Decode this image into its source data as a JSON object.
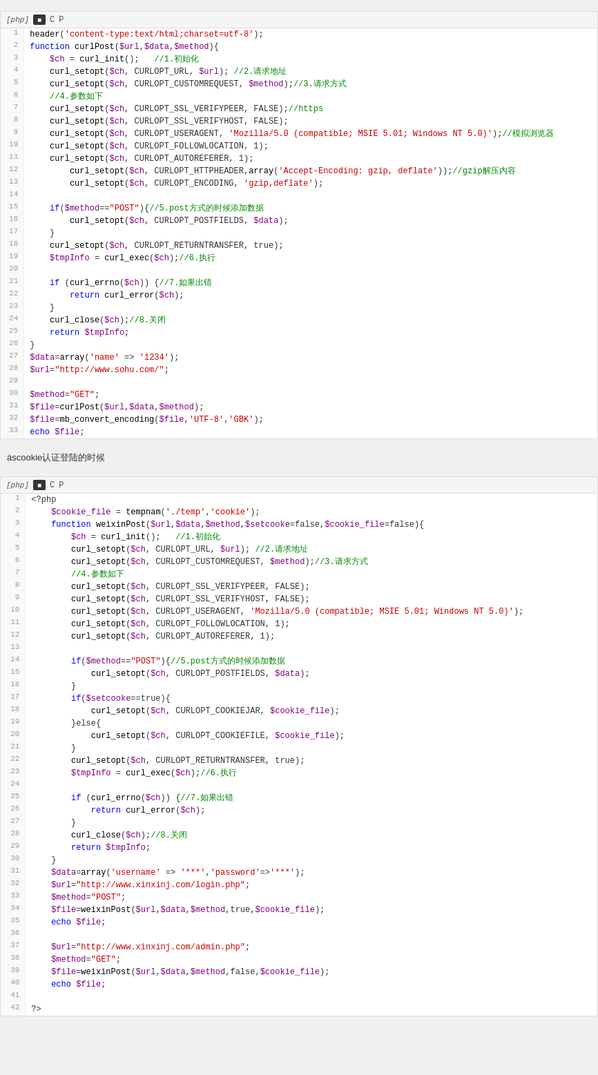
{
  "blocks": [
    {
      "id": "block1",
      "lang": "[php]",
      "lines": [
        {
          "n": 1,
          "html": "<span class='fn'>header</span><span class='plain'>(</span><span class='str'>'content-type:text/html;charset=utf-8'</span><span class='plain'>);</span>"
        },
        {
          "n": 2,
          "html": "<span class='kw'>function</span> <span class='fn'>curlPost</span><span class='plain'>(</span><span class='var'>$url</span><span class='plain'>,</span><span class='var'>$data</span><span class='plain'>,</span><span class='var'>$method</span><span class='plain'>){</span>"
        },
        {
          "n": 3,
          "html": "    <span class='var'>$ch</span><span class='plain'> = </span><span class='fn'>curl_init</span><span class='plain'>();   </span><span class='cmt'>//1.初始化</span>"
        },
        {
          "n": 4,
          "html": "    <span class='fn'>curl_setopt</span><span class='plain'>(</span><span class='var'>$ch</span><span class='plain'>, CURLOPT_URL, </span><span class='var'>$url</span><span class='plain'>); </span><span class='cmt'>//2.请求地址</span>"
        },
        {
          "n": 5,
          "html": "    <span class='fn'>curl_setopt</span><span class='plain'>(</span><span class='var'>$ch</span><span class='plain'>, CURLOPT_CUSTOMREQUEST, </span><span class='var'>$method</span><span class='plain'>);</span><span class='cmt'>//3.请求方式</span>"
        },
        {
          "n": 6,
          "html": "    <span class='cmt'>//4.参数如下</span>"
        },
        {
          "n": 7,
          "html": "    <span class='fn'>curl_setopt</span><span class='plain'>(</span><span class='var'>$ch</span><span class='plain'>, CURLOPT_SSL_VERIFYPEER, FALSE);</span><span class='cmt'>//https</span>"
        },
        {
          "n": 8,
          "html": "    <span class='fn'>curl_setopt</span><span class='plain'>(</span><span class='var'>$ch</span><span class='plain'>, CURLOPT_SSL_VERIFYHOST, FALSE);</span>"
        },
        {
          "n": 9,
          "html": "    <span class='fn'>curl_setopt</span><span class='plain'>(</span><span class='var'>$ch</span><span class='plain'>, CURLOPT_USERAGENT, </span><span class='str'>'Mozilla/5.0 (compatible; MSIE 5.01; Windows NT 5.0)'</span><span class='plain'>);</span><span class='cmt'>//模拟浏览器</span>"
        },
        {
          "n": 10,
          "html": "    <span class='fn'>curl_setopt</span><span class='plain'>(</span><span class='var'>$ch</span><span class='plain'>, CURLOPT_FOLLOWLOCATION, 1);</span>"
        },
        {
          "n": 11,
          "html": "    <span class='fn'>curl_setopt</span><span class='plain'>(</span><span class='var'>$ch</span><span class='plain'>, CURLOPT_AUTOREFERER, 1);</span>"
        },
        {
          "n": 12,
          "html": "        <span class='fn'>curl_setopt</span><span class='plain'>(</span><span class='var'>$ch</span><span class='plain'>, CURLOPT_HTTPHEADER,</span><span class='fn'>array</span><span class='plain'>(</span><span class='str'>'Accept-Encoding: gzip, deflate'</span><span class='plain'>));</span><span class='cmt'>//gzip解压内容</span>"
        },
        {
          "n": 13,
          "html": "        <span class='fn'>curl_setopt</span><span class='plain'>(</span><span class='var'>$ch</span><span class='plain'>, CURLOPT_ENCODING, </span><span class='str'>'gzip,deflate'</span><span class='plain'>);</span>"
        },
        {
          "n": 14,
          "html": ""
        },
        {
          "n": 15,
          "html": "    <span class='kw'>if</span><span class='plain'>(</span><span class='var'>$method</span><span class='plain'>==</span><span class='str'>\"POST\"</span><span class='plain'>){</span><span class='cmt'>//5.post方式的时候添加数据</span>"
        },
        {
          "n": 16,
          "html": "        <span class='fn'>curl_setopt</span><span class='plain'>(</span><span class='var'>$ch</span><span class='plain'>, CURLOPT_POSTFIELDS, </span><span class='var'>$data</span><span class='plain'>);</span>"
        },
        {
          "n": 17,
          "html": "    <span class='plain'>}</span>"
        },
        {
          "n": 18,
          "html": "    <span class='fn'>curl_setopt</span><span class='plain'>(</span><span class='var'>$ch</span><span class='plain'>, CURLOPT_RETURNTRANSFER, true);</span>"
        },
        {
          "n": 19,
          "html": "    <span class='var'>$tmpInfo</span><span class='plain'> = </span><span class='fn'>curl_exec</span><span class='plain'>(</span><span class='var'>$ch</span><span class='plain'>);</span><span class='cmt'>//6.执行</span>"
        },
        {
          "n": 20,
          "html": ""
        },
        {
          "n": 21,
          "html": "    <span class='kw'>if</span><span class='plain'> (</span><span class='fn'>curl_errno</span><span class='plain'>(</span><span class='var'>$ch</span><span class='plain'>)) {</span><span class='cmt'>//7.如果出错</span>"
        },
        {
          "n": 22,
          "html": "        <span class='kw'>return</span> <span class='fn'>curl_error</span><span class='plain'>(</span><span class='var'>$ch</span><span class='plain'>);</span>"
        },
        {
          "n": 23,
          "html": "    <span class='plain'>}</span>"
        },
        {
          "n": 24,
          "html": "    <span class='fn'>curl_close</span><span class='plain'>(</span><span class='var'>$ch</span><span class='plain'>);</span><span class='cmt'>//8.关闭</span>"
        },
        {
          "n": 25,
          "html": "    <span class='kw'>return</span> <span class='var'>$tmpInfo</span><span class='plain'>;</span>"
        },
        {
          "n": 26,
          "html": "<span class='plain'>}</span>"
        },
        {
          "n": 27,
          "html": "<span class='var'>$data</span><span class='plain'>=</span><span class='fn'>array</span><span class='plain'>(</span><span class='str'>'name'</span><span class='plain'> => </span><span class='str'>'1234'</span><span class='plain'>);</span>"
        },
        {
          "n": 28,
          "html": "<span class='var'>$url</span><span class='plain'>=</span><span class='str'>\"http://www.sohu.com/\"</span><span class='plain'>;</span>"
        },
        {
          "n": 29,
          "html": ""
        },
        {
          "n": 30,
          "html": "<span class='var'>$method</span><span class='plain'>=</span><span class='str'>\"GET\"</span><span class='plain'>;</span>"
        },
        {
          "n": 31,
          "html": "<span class='var'>$file</span><span class='plain'>=</span><span class='fn'>curlPost</span><span class='plain'>(</span><span class='var'>$url</span><span class='plain'>,</span><span class='var'>$data</span><span class='plain'>,</span><span class='var'>$method</span><span class='plain'>);</span>"
        },
        {
          "n": 32,
          "html": "<span class='var'>$file</span><span class='plain'>=</span><span class='fn'>mb_convert_encoding</span><span class='plain'>(</span><span class='var'>$file</span><span class='plain'>,</span><span class='str'>'UTF-8'</span><span class='plain'>,</span><span class='str'>'GBK'</span><span class='plain'>);</span>"
        },
        {
          "n": 33,
          "html": "<span class='kw'>echo</span> <span class='var'>$file</span><span class='plain'>;</span>"
        }
      ]
    },
    {
      "id": "block2",
      "lang": "[php]",
      "sectionLabel": "áscookie认证登陆的时候",
      "lines": [
        {
          "n": 1,
          "html": "<span class='plain'>&lt;?php</span>"
        },
        {
          "n": 2,
          "html": "    <span class='var'>$cookie_file</span><span class='plain'> = </span><span class='fn'>tempnam</span><span class='plain'>(</span><span class='str'>'./temp'</span><span class='plain'>,</span><span class='str'>'cookie'</span><span class='plain'>);</span>"
        },
        {
          "n": 3,
          "html": "    <span class='kw'>function</span> <span class='fn'>weixinPost</span><span class='plain'>(</span><span class='var'>$url</span><span class='plain'>,</span><span class='var'>$data</span><span class='plain'>,</span><span class='var'>$method</span><span class='plain'>,</span><span class='var'>$setcooke</span><span class='plain'>=false,</span><span class='var'>$cookie_file</span><span class='plain'>=false){</span>"
        },
        {
          "n": 4,
          "html": "        <span class='var'>$ch</span><span class='plain'> = </span><span class='fn'>curl_init</span><span class='plain'>();   </span><span class='cmt'>//1.初始化</span>"
        },
        {
          "n": 5,
          "html": "        <span class='fn'>curl_setopt</span><span class='plain'>(</span><span class='var'>$ch</span><span class='plain'>, CURLOPT_URL, </span><span class='var'>$url</span><span class='plain'>); </span><span class='cmt'>//2.请求地址</span>"
        },
        {
          "n": 6,
          "html": "        <span class='fn'>curl_setopt</span><span class='plain'>(</span><span class='var'>$ch</span><span class='plain'>, CURLOPT_CUSTOMREQUEST, </span><span class='var'>$method</span><span class='plain'>);</span><span class='cmt'>//3.请求方式</span>"
        },
        {
          "n": 7,
          "html": "        <span class='cmt'>//4.参数如下</span>"
        },
        {
          "n": 8,
          "html": "        <span class='fn'>curl_setopt</span><span class='plain'>(</span><span class='var'>$ch</span><span class='plain'>, CURLOPT_SSL_VERIFYPEER, FALSE);</span>"
        },
        {
          "n": 9,
          "html": "        <span class='fn'>curl_setopt</span><span class='plain'>(</span><span class='var'>$ch</span><span class='plain'>, CURLOPT_SSL_VERIFYHOST, FALSE);</span>"
        },
        {
          "n": 10,
          "html": "        <span class='fn'>curl_setopt</span><span class='plain'>(</span><span class='var'>$ch</span><span class='plain'>, CURLOPT_USERAGENT, </span><span class='str'>'Mozilla/5.0 (compatible; MSIE 5.01; Windows NT 5.0)'</span><span class='plain'>);</span>"
        },
        {
          "n": 11,
          "html": "        <span class='fn'>curl_setopt</span><span class='plain'>(</span><span class='var'>$ch</span><span class='plain'>, CURLOPT_FOLLOWLOCATION, 1);</span>"
        },
        {
          "n": 12,
          "html": "        <span class='fn'>curl_setopt</span><span class='plain'>(</span><span class='var'>$ch</span><span class='plain'>, CURLOPT_AUTOREFERER, 1);</span>"
        },
        {
          "n": 13,
          "html": ""
        },
        {
          "n": 14,
          "html": "        <span class='kw'>if</span><span class='plain'>(</span><span class='var'>$method</span><span class='plain'>==</span><span class='str'>\"POST\"</span><span class='plain'>){</span><span class='cmt'>//5.post方式的时候添加数据</span>"
        },
        {
          "n": 15,
          "html": "            <span class='fn'>curl_setopt</span><span class='plain'>(</span><span class='var'>$ch</span><span class='plain'>, CURLOPT_POSTFIELDS, </span><span class='var'>$data</span><span class='plain'>);</span>"
        },
        {
          "n": 16,
          "html": "        <span class='plain'>}</span>"
        },
        {
          "n": 17,
          "html": "        <span class='kw'>if</span><span class='plain'>(</span><span class='var'>$setcooke</span><span class='plain'>==true){</span>"
        },
        {
          "n": 18,
          "html": "            <span class='fn'>curl_setopt</span><span class='plain'>(</span><span class='var'>$ch</span><span class='plain'>, CURLOPT_COOKIEJAR, </span><span class='var'>$cookie_file</span><span class='plain'>);</span>"
        },
        {
          "n": 19,
          "html": "        <span class='plain'>}else{</span>"
        },
        {
          "n": 20,
          "html": "            <span class='fn'>curl_setopt</span><span class='plain'>(</span><span class='var'>$ch</span><span class='plain'>, CURLOPT_COOKIEFILE, </span><span class='var'>$cookie_file</span><span class='plain'>);</span>"
        },
        {
          "n": 21,
          "html": "        <span class='plain'>}</span>"
        },
        {
          "n": 22,
          "html": "        <span class='fn'>curl_setopt</span><span class='plain'>(</span><span class='var'>$ch</span><span class='plain'>, CURLOPT_RETURNTRANSFER, true);</span>"
        },
        {
          "n": 23,
          "html": "        <span class='var'>$tmpInfo</span><span class='plain'> = </span><span class='fn'>curl_exec</span><span class='plain'>(</span><span class='var'>$ch</span><span class='plain'>);</span><span class='cmt'>//6.执行</span>"
        },
        {
          "n": 24,
          "html": ""
        },
        {
          "n": 25,
          "html": "        <span class='kw'>if</span><span class='plain'> (</span><span class='fn'>curl_errno</span><span class='plain'>(</span><span class='var'>$ch</span><span class='plain'>)) {</span><span class='cmt'>//7.如果出错</span>"
        },
        {
          "n": 26,
          "html": "            <span class='kw'>return</span> <span class='fn'>curl_error</span><span class='plain'>(</span><span class='var'>$ch</span><span class='plain'>);</span>"
        },
        {
          "n": 27,
          "html": "        <span class='plain'>}</span>"
        },
        {
          "n": 28,
          "html": "        <span class='fn'>curl_close</span><span class='plain'>(</span><span class='var'>$ch</span><span class='plain'>);</span><span class='cmt'>//8.关闭</span>"
        },
        {
          "n": 29,
          "html": "        <span class='kw'>return</span> <span class='var'>$tmpInfo</span><span class='plain'>;</span>"
        },
        {
          "n": 30,
          "html": "    <span class='plain'>}</span>"
        },
        {
          "n": 31,
          "html": "    <span class='var'>$data</span><span class='plain'>=</span><span class='fn'>array</span><span class='plain'>(</span><span class='str'>'username'</span><span class='plain'> => </span><span class='str'>'***'</span><span class='plain'>,</span><span class='str'>'password'</span><span class='plain'>=></span><span class='str'>'***'</span><span class='plain'>);</span>"
        },
        {
          "n": 32,
          "html": "    <span class='var'>$url</span><span class='plain'>=</span><span class='str'>\"http://www.xinxinj.com/login.php\"</span><span class='plain'>;</span>"
        },
        {
          "n": 33,
          "html": "    <span class='var'>$method</span><span class='plain'>=</span><span class='str'>\"POST\"</span><span class='plain'>;</span>"
        },
        {
          "n": 34,
          "html": "    <span class='var'>$file</span><span class='plain'>=</span><span class='fn'>weixinPost</span><span class='plain'>(</span><span class='var'>$url</span><span class='plain'>,</span><span class='var'>$data</span><span class='plain'>,</span><span class='var'>$method</span><span class='plain'>,true,</span><span class='var'>$cookie_file</span><span class='plain'>);</span>"
        },
        {
          "n": 35,
          "html": "    <span class='kw'>echo</span> <span class='var'>$file</span><span class='plain'>;</span>"
        },
        {
          "n": 36,
          "html": ""
        },
        {
          "n": 37,
          "html": "    <span class='var'>$url</span><span class='plain'>=</span><span class='str'>\"http://www.xinxinj.com/admin.php\"</span><span class='plain'>;</span>"
        },
        {
          "n": 38,
          "html": "    <span class='var'>$method</span><span class='plain'>=</span><span class='str'>\"GET\"</span><span class='plain'>;</span>"
        },
        {
          "n": 39,
          "html": "    <span class='var'>$file</span><span class='plain'>=</span><span class='fn'>weixinPost</span><span class='plain'>(</span><span class='var'>$url</span><span class='plain'>,</span><span class='var'>$data</span><span class='plain'>,</span><span class='var'>$method</span><span class='plain'>,false,</span><span class='var'>$cookie_file</span><span class='plain'>);</span>"
        },
        {
          "n": 40,
          "html": "    <span class='kw'>echo</span> <span class='var'>$file</span><span class='plain'>;</span>"
        },
        {
          "n": 41,
          "html": ""
        },
        {
          "n": 42,
          "html": "<span class='plain'>?&gt;</span>"
        }
      ]
    }
  ],
  "section_label": "áscookie认证登陆的时候",
  "toolbar": {
    "copy_label": "C",
    "print_label": "P"
  }
}
